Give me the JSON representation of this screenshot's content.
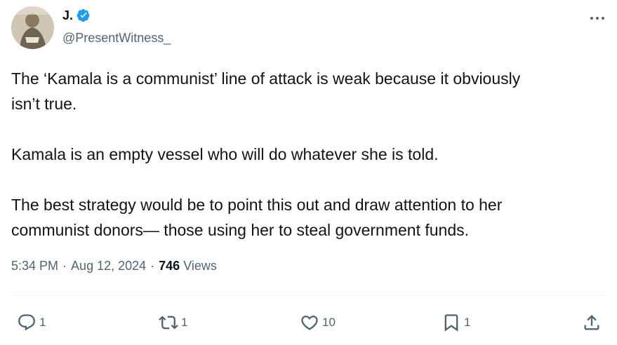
{
  "tweet": {
    "author": {
      "display_name": "J.",
      "handle": "@PresentWitness_",
      "verified": true,
      "avatar_icon": "avatar-image"
    },
    "text": {
      "p1_line1": "The ‘Kamala is a communist’ line of attack is weak because it obviously",
      "p1_line2": "isn’t true.",
      "p2_line1": "Kamala is an empty vessel who will do whatever she is told.",
      "p3_line1": "The best strategy would be to point this out and draw attention to her",
      "p3_line2": "communist donors— those using her to steal government funds."
    },
    "meta": {
      "time": "5:34 PM",
      "date": "Aug 12, 2024",
      "separator": "·",
      "views_count": "746",
      "views_label": "Views"
    },
    "actions": {
      "reply_count": "1",
      "retweet_count": "1",
      "like_count": "10",
      "bookmark_count": "1"
    },
    "colors": {
      "text": "#0f1419",
      "secondary": "#536471",
      "verified": "#1d9bf0",
      "divider": "#eff3f4"
    }
  }
}
